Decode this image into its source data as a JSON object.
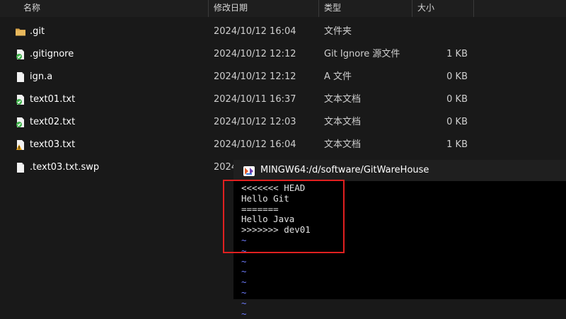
{
  "columns": {
    "name": "名称",
    "modified": "修改日期",
    "type": "类型",
    "size": "大小"
  },
  "files": [
    {
      "name": ".git",
      "modified": "2024/10/12 16:04",
      "type": "文件夹",
      "size": "",
      "icon": "folder-icon"
    },
    {
      "name": ".gitignore",
      "modified": "2024/10/12 12:12",
      "type": "Git Ignore 源文件",
      "size": "1 KB",
      "icon": "file-synced-icon"
    },
    {
      "name": "ign.a",
      "modified": "2024/10/12 12:12",
      "type": "A 文件",
      "size": "0 KB",
      "icon": "file-icon"
    },
    {
      "name": "text01.txt",
      "modified": "2024/10/11 16:37",
      "type": "文本文档",
      "size": "0 KB",
      "icon": "file-synced-icon"
    },
    {
      "name": "text02.txt",
      "modified": "2024/10/12 12:03",
      "type": "文本文档",
      "size": "0 KB",
      "icon": "file-synced-icon"
    },
    {
      "name": "text03.txt",
      "modified": "2024/10/12 16:04",
      "type": "文本文档",
      "size": "1 KB",
      "icon": "file-conflict-icon"
    },
    {
      "name": ".text03.txt.swp",
      "modified": "2024/",
      "type": "",
      "size": "",
      "icon": "file-icon"
    }
  ],
  "terminal": {
    "title": "MINGW64:/d/software/GitWareHouse",
    "lines": [
      "<<<<<<< HEAD",
      "Hello Git",
      "=======",
      "Hello Java",
      ">>>>>>> dev01"
    ],
    "tilde": "~",
    "tilde_count": 8
  },
  "colors": {
    "synced": "#3fb14a",
    "conflict": "#e8a317",
    "folder": "#d9a54a",
    "highlight": "#e02020",
    "tilde": "#6f7cff"
  }
}
